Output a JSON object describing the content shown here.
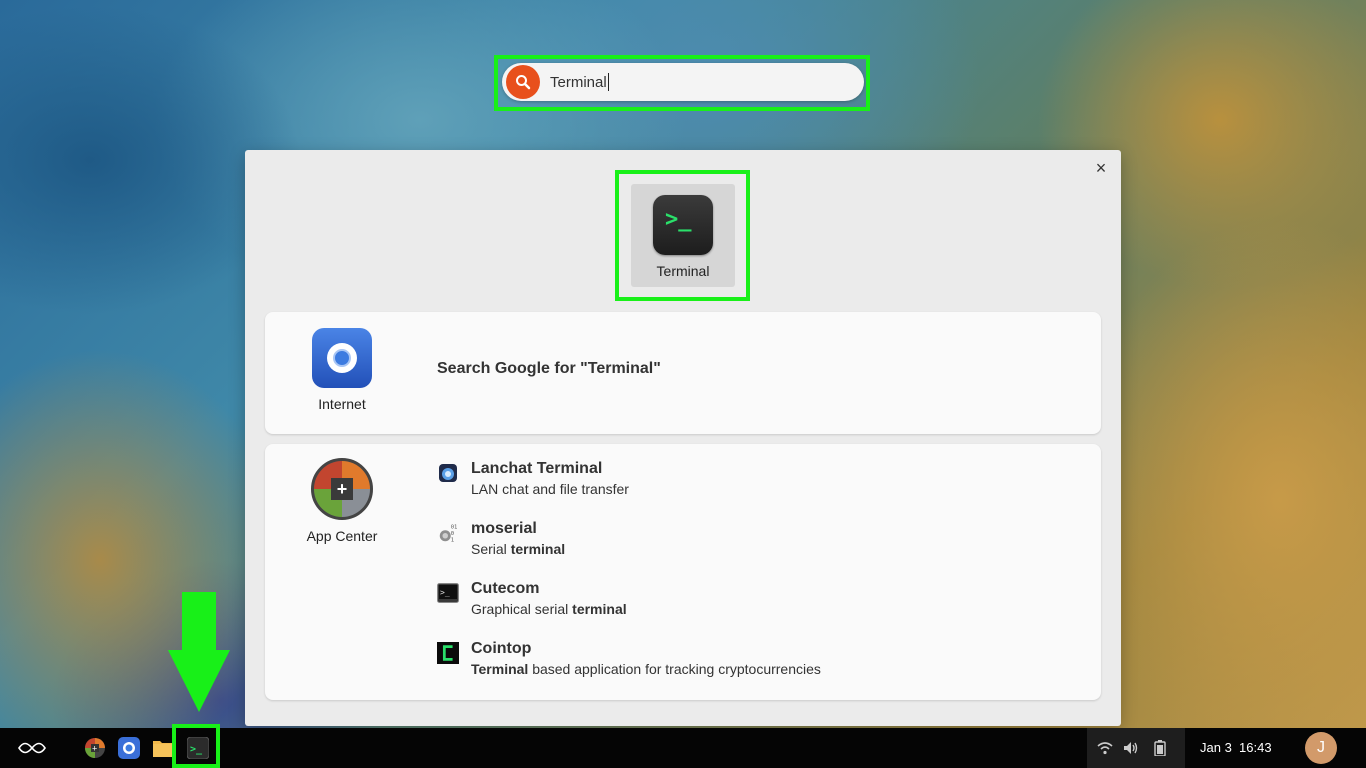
{
  "search": {
    "value": "Terminal"
  },
  "panel": {
    "close_label": "×",
    "top_hit": {
      "label": "Terminal"
    },
    "internet": {
      "category": "Internet",
      "google_search": "Search Google for \"Terminal\""
    },
    "app_center": {
      "category": "App Center",
      "results": [
        {
          "title": "Lanchat Terminal",
          "desc": "LAN chat and file transfer",
          "icon": "lanchat-icon"
        },
        {
          "title": "moserial",
          "desc_pre": "Serial ",
          "desc_bold": "terminal",
          "desc_post": "",
          "icon": "moserial-icon"
        },
        {
          "title": "Cutecom",
          "desc_pre": "Graphical serial ",
          "desc_bold": "terminal",
          "desc_post": "",
          "icon": "cutecom-icon"
        },
        {
          "title": "Cointop",
          "desc_pre": "",
          "desc_bold": "Terminal",
          "desc_post": " based application for tracking cryptocurrencies",
          "icon": "cointop-icon"
        }
      ]
    }
  },
  "taskbar": {
    "date": "Jan 3",
    "time": "16:43",
    "avatar_initial": "J"
  },
  "colors": {
    "highlight": "#18f018",
    "search_accent": "#e8501c",
    "terminal_green": "#2ae06a"
  }
}
